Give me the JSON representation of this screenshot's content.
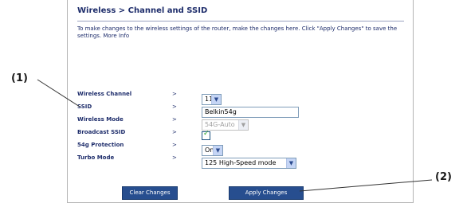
{
  "header": {
    "title": "Wireless > Channel and SSID",
    "description": "To make changes to the wireless settings of the router, make the changes here. Click \"Apply Changes\" to save the settings.",
    "more_info": "More Info"
  },
  "form": {
    "separator": ">",
    "wireless_channel": {
      "label": "Wireless Channel",
      "value": "11"
    },
    "ssid": {
      "label": "SSID",
      "value": "Belkin54g"
    },
    "wireless_mode": {
      "label": "Wireless Mode",
      "value": "54G-Auto",
      "disabled": true
    },
    "broadcast_ssid": {
      "label": "Broadcast SSID",
      "checked": true,
      "check_glyph": "✓"
    },
    "protection_54g": {
      "label": "54g Protection",
      "value": "On"
    },
    "turbo_mode": {
      "label": "Turbo Mode",
      "value": "125 High-Speed mode"
    }
  },
  "buttons": {
    "clear": "Clear Changes",
    "apply": "Apply Changes"
  },
  "callouts": {
    "one": "(1)",
    "two": "(2)"
  },
  "icons": {
    "dropdown": "chevron-down-icon",
    "arrow_glyph": "▼"
  },
  "colors": {
    "heading": "#1e2d6b",
    "button": "#274e8f",
    "checkmark": "#21a121"
  }
}
